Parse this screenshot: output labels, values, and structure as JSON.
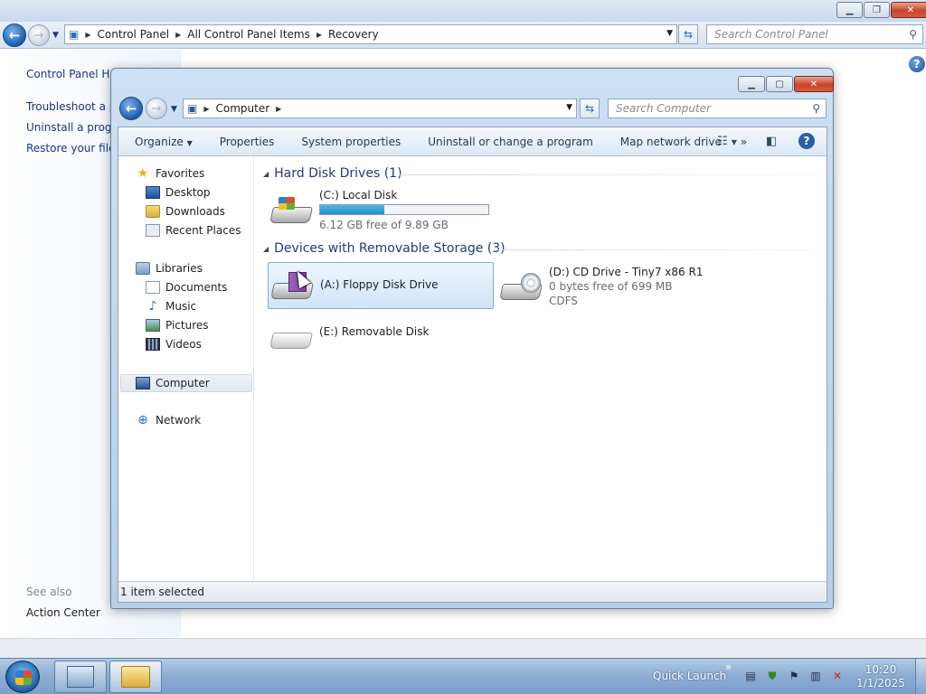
{
  "control_panel": {
    "address": [
      "Control Panel",
      "All Control Panel Items",
      "Recovery"
    ],
    "search_placeholder": "Search Control Panel",
    "left_links": [
      "Control Panel Ho",
      "Troubleshoot a pr",
      "Uninstall a progra",
      "Restore your files"
    ],
    "see_also_label": "See also",
    "see_also_links": [
      "Action Center"
    ]
  },
  "explorer": {
    "address": [
      "Computer"
    ],
    "search_placeholder": "Search Computer",
    "commands": {
      "organize": "Organize",
      "properties": "Properties",
      "system_properties": "System properties",
      "uninstall": "Uninstall or change a program",
      "map_drive": "Map network drive",
      "more": "»"
    },
    "nav": {
      "favorites": "Favorites",
      "desktop": "Desktop",
      "downloads": "Downloads",
      "recent_places": "Recent Places",
      "libraries": "Libraries",
      "documents": "Documents",
      "music": "Music",
      "pictures": "Pictures",
      "videos": "Videos",
      "computer": "Computer",
      "network": "Network"
    },
    "groups": {
      "hdd": "Hard Disk Drives (1)",
      "removable": "Devices with Removable Storage (3)"
    },
    "drives": {
      "c": {
        "name": "(C:) Local Disk",
        "detail": "6.12 GB free of 9.89 GB",
        "used_fraction": 0.38
      },
      "a": {
        "name": "(A:) Floppy Disk Drive"
      },
      "d": {
        "name": "(D:) CD Drive - Tiny7 x86 R1",
        "detail": "0 bytes free of 699 MB",
        "fs": "CDFS"
      },
      "e": {
        "name": "(E:) Removable Disk"
      }
    },
    "status": "1 item selected"
  },
  "taskbar": {
    "quick_launch": "Quick Launch",
    "chevron": "»",
    "time": "10:20",
    "date": "1/1/2025"
  },
  "colors": {
    "link_blue": "#1e3287",
    "group_header": "#1e3c78",
    "selection": "#cfe4f7",
    "usage_bar": "#1f8fc8"
  }
}
